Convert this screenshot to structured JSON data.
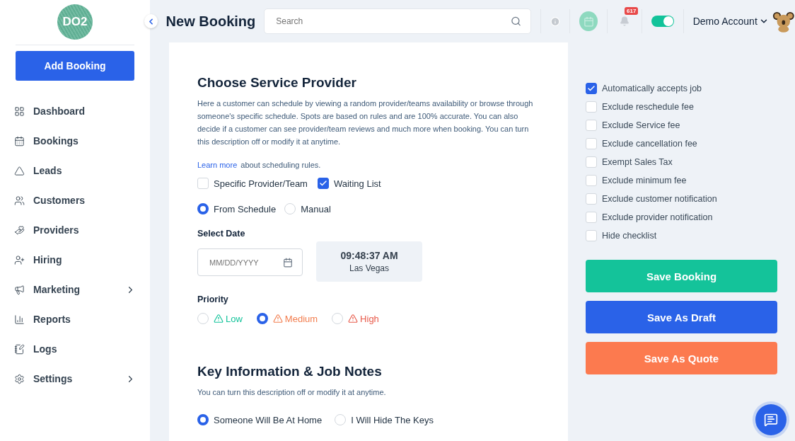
{
  "sidebar": {
    "logo_text": "DO2",
    "add_button": "Add Booking",
    "items": [
      {
        "label": "Dashboard",
        "has_submenu": false
      },
      {
        "label": "Bookings",
        "has_submenu": false
      },
      {
        "label": "Leads",
        "has_submenu": false
      },
      {
        "label": "Customers",
        "has_submenu": false
      },
      {
        "label": "Providers",
        "has_submenu": false
      },
      {
        "label": "Hiring",
        "has_submenu": false
      },
      {
        "label": "Marketing",
        "has_submenu": true
      },
      {
        "label": "Reports",
        "has_submenu": false
      },
      {
        "label": "Logs",
        "has_submenu": false
      },
      {
        "label": "Settings",
        "has_submenu": true
      }
    ]
  },
  "header": {
    "title": "New Booking",
    "search": {
      "placeholder": "Search"
    },
    "notification_count": "617",
    "toggle_on": true,
    "account": "Demo Account"
  },
  "provider_section": {
    "title": "Choose Service Provider",
    "description": "Here a customer can schedule by viewing a random provider/teams availability or browse through someone's specific schedule. Spots are based on rules and are 100% accurate. You can also decide if a customer can see provider/team reviews and much more when booking. You can turn this description off or modify it at anytime.",
    "learn_more_link": "Learn more",
    "learn_more_text": "about scheduling rules.",
    "options": [
      {
        "label": "Specific Provider/Team",
        "checked": false
      },
      {
        "label": "Waiting List",
        "checked": true
      }
    ],
    "schedule_modes": [
      {
        "label": "From Schedule",
        "selected": true
      },
      {
        "label": "Manual",
        "selected": false
      }
    ],
    "date_label": "Select Date",
    "date_field": {
      "placeholder": "MM/DD/YYYY"
    },
    "clock": {
      "time": "09:48:37 AM",
      "city": "Las Vegas"
    },
    "priority_label": "Priority",
    "priorities": [
      {
        "label": "Low",
        "selected": false,
        "color": "#12c39a"
      },
      {
        "label": "Medium",
        "selected": true,
        "color": "#f27d4e"
      },
      {
        "label": "High",
        "selected": false,
        "color": "#e85a4a"
      }
    ]
  },
  "key_section": {
    "title": "Key Information & Job Notes",
    "description": "You can turn this description off or modify it at anytime.",
    "options": [
      {
        "label": "Someone Will Be At Home",
        "selected": true
      },
      {
        "label": "I Will Hide The Keys",
        "selected": false
      }
    ]
  },
  "settings": [
    {
      "label": "Automatically accepts job",
      "checked": true
    },
    {
      "label": "Exclude reschedule fee",
      "checked": false
    },
    {
      "label": "Exclude Service fee",
      "checked": false
    },
    {
      "label": "Exclude cancellation fee",
      "checked": false
    },
    {
      "label": "Exempt Sales Tax",
      "checked": false
    },
    {
      "label": "Exclude minimum fee",
      "checked": false
    },
    {
      "label": "Exclude customer notification",
      "checked": false
    },
    {
      "label": "Exclude provider notification",
      "checked": false
    },
    {
      "label": "Hide checklist",
      "checked": false
    }
  ],
  "actions": [
    {
      "label": "Save Booking",
      "color": "#14c39a"
    },
    {
      "label": "Save As Draft",
      "color": "#2a62e8"
    },
    {
      "label": "Save As Quote",
      "color": "#fc7a4f"
    }
  ]
}
